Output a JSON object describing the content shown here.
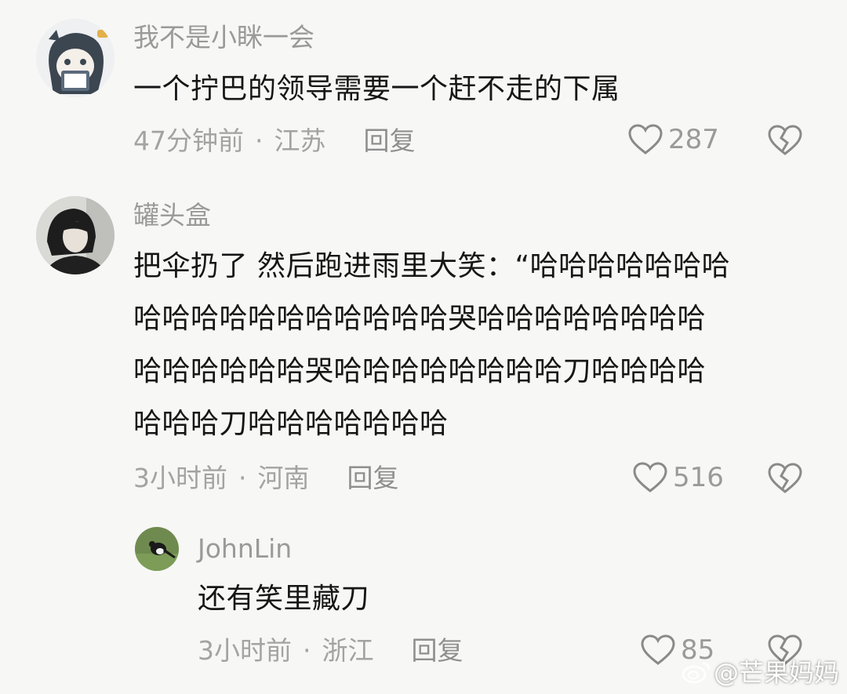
{
  "comments": [
    {
      "username": "我不是小眯一会",
      "text": "一个拧巴的领导需要一个赶不走的下属",
      "time": "47分钟前",
      "separator": "·",
      "location": "江苏",
      "reply_label": "回复",
      "likes": "287"
    },
    {
      "username": "罐头盒",
      "text_lines": [
        "把伞扔了 然后跑进雨里大笑：“哈哈哈哈哈哈哈",
        "哈哈哈哈哈哈哈哈哈哈哈哭哈哈哈哈哈哈哈哈",
        "哈哈哈哈哈哈哭哈哈哈哈哈哈哈哈刀哈哈哈哈",
        "哈哈哈刀哈哈哈哈哈哈哈"
      ],
      "time": "3小时前",
      "separator": "·",
      "location": "河南",
      "reply_label": "回复",
      "likes": "516"
    },
    {
      "username": "JohnLin",
      "text": "还有笑里藏刀",
      "time": "3小时前",
      "separator": "·",
      "location": "浙江",
      "reply_label": "回复",
      "likes": "85"
    }
  ],
  "watermark": "@芒果妈妈",
  "icons": {
    "like": "heart-outline-icon",
    "dislike": "broken-heart-icon",
    "watermark": "weibo-logo-icon"
  }
}
